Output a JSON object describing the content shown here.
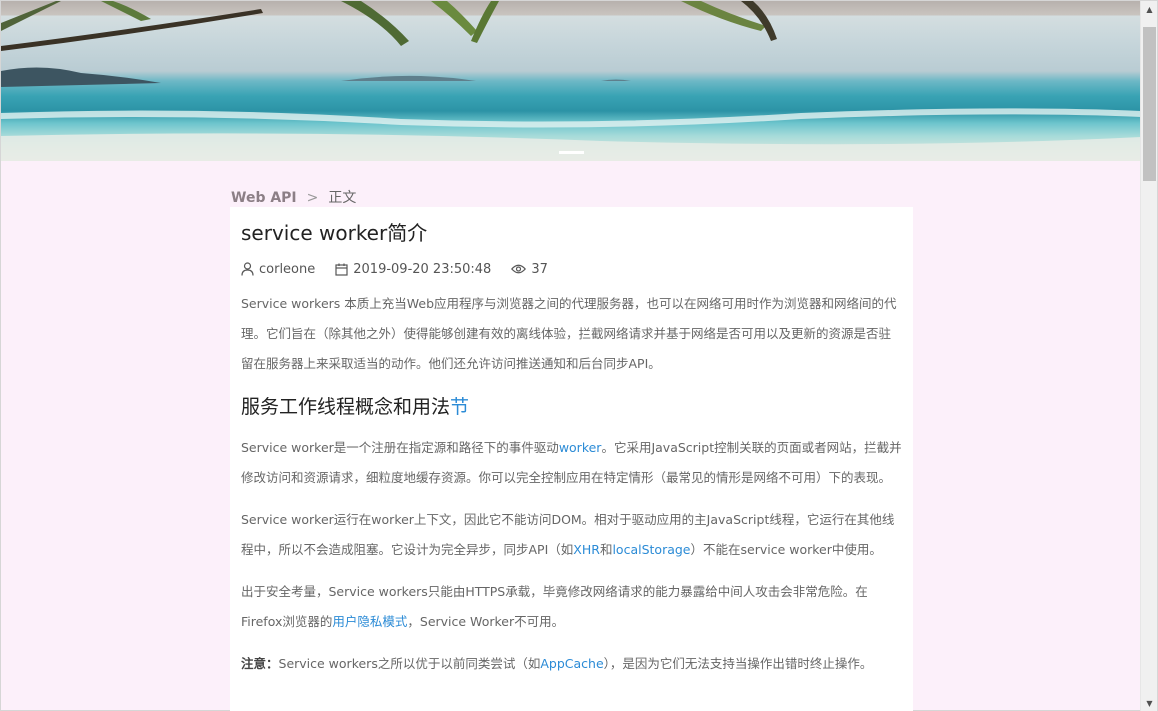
{
  "breadcrumb": {
    "section": "Web API",
    "separator": ">",
    "current": "正文"
  },
  "article": {
    "title": "service worker简介",
    "author": "corleone",
    "date": "2019-09-20 23:50:48",
    "views": "37",
    "intro": "Service workers 本质上充当Web应用程序与浏览器之间的代理服务器，也可以在网络可用时作为浏览器和网络间的代理。它们旨在（除其他之外）使得能够创建有效的离线体验，拦截网络请求并基于网络是否可用以及更新的资源是否驻留在服务器上来采取适当的动作。他们还允许访问推送通知和后台同步API。",
    "section_heading": "服务工作线程概念和用法",
    "section_heading_link": "节",
    "p1_a": "Service worker是一个注册在指定源和路径下的事件驱动",
    "p1_link": "worker",
    "p1_b": "。它采用JavaScript控制关联的页面或者网站，拦截并修改访问和资源请求，细粒度地缓存资源。你可以完全控制应用在特定情形（最常见的情形是网络不可用）下的表现。",
    "p2_a": "Service worker运行在worker上下文，因此它不能访问DOM。相对于驱动应用的主JavaScript线程，它运行在其他线程中，所以不会造成阻塞。它设计为完全异步，同步API（如",
    "p2_link1": "XHR",
    "p2_mid": "和",
    "p2_link2": "localStorage",
    "p2_b": "）不能在service worker中使用。",
    "p3_a": "出于安全考量，Service workers只能由HTTPS承载，毕竟修改网络请求的能力暴露给中间人攻击会非常危险。在Firefox浏览器的",
    "p3_link": "用户隐私模式",
    "p3_b": "，Service Worker不可用。",
    "p4_label": "注意：",
    "p4_a": "Service workers之所以优于以前同类尝试（如",
    "p4_link": "AppCache",
    "p4_b": "），是因为它们无法支持当操作出错时终止操作。"
  },
  "scrollbar": {
    "up_glyph": "▲",
    "down_glyph": "▼"
  },
  "colors": {
    "page_bg": "#fcf0fa",
    "link": "#2b8bd6",
    "card_bg": "#ffffff"
  }
}
